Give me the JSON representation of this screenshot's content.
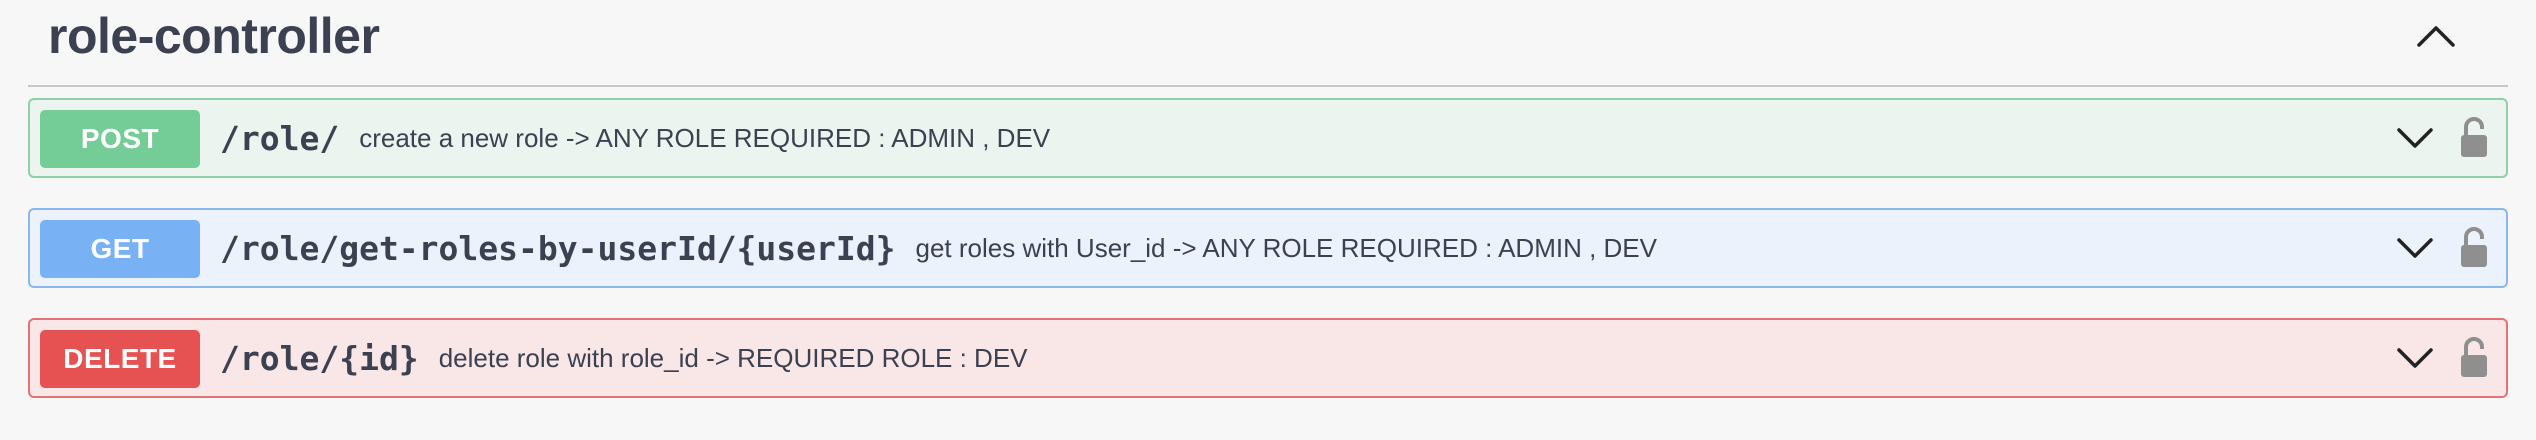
{
  "tag": {
    "title": "role-controller",
    "collapse_icon": "chevron-up-icon"
  },
  "operations": [
    {
      "method": "POST",
      "path": "/role/",
      "description": "create a new role -> ANY ROLE REQUIRED : ADMIN , DEV",
      "color": "#49cc90"
    },
    {
      "method": "GET",
      "path": "/role/get-roles-by-userId/{userId}",
      "description": "get roles with User_id -> ANY ROLE REQUIRED : ADMIN , DEV",
      "color": "#61affe"
    },
    {
      "method": "DELETE",
      "path": "/role/{id}",
      "description": "delete role with role_id -> REQUIRED ROLE : DEV",
      "color": "#f93e3e"
    }
  ],
  "icons": {
    "expand": "chevron-down-icon",
    "auth": "unlocked-icon"
  }
}
